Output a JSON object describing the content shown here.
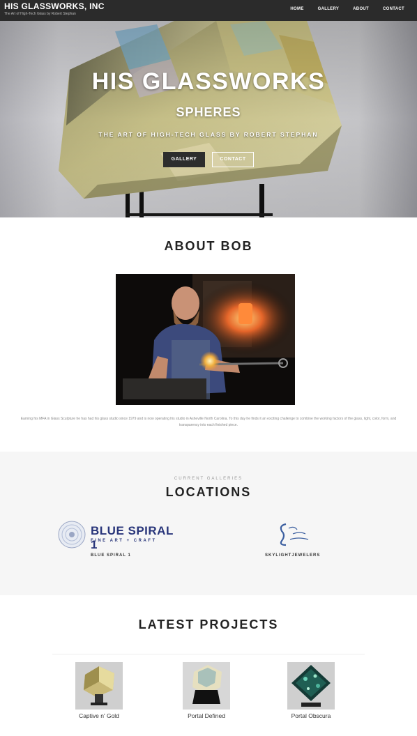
{
  "site": {
    "title": "HIS GLASSWORKS, INC",
    "tagline": "The Art of High-Tech Glass by Robert Stephan"
  },
  "nav": {
    "items": [
      {
        "label": "HOME"
      },
      {
        "label": "GALLERY"
      },
      {
        "label": "ABOUT"
      },
      {
        "label": "CONTACT"
      }
    ]
  },
  "hero": {
    "title": "HIS GLASSWORKS",
    "subtitle": "SPHERES",
    "tagline": "THE ART OF HIGH-TECH GLASS BY ROBERT STEPHAN",
    "gallery_button": "GALLERY",
    "contact_button": "CONTACT"
  },
  "about": {
    "title": "ABOUT BOB",
    "bio": "Earning his MFA in Glass Sculpture he has had his glass studio since 1979 and is now operating his studio in Asheville North Carolina. To this day he finds it an exciting challenge to combine the working factors of the glass, light, color, form, and transparency into each finished piece."
  },
  "locations": {
    "eyebrow": "CURRENT GALLERIES",
    "title": "LOCATIONS",
    "galleries": [
      {
        "logo_text": "BLUE SPIRAL 1",
        "logo_subtext": "FINE ART + CRAFT",
        "label": "BLUE SPIRAL 1"
      },
      {
        "logo_text": "Skylight Jewelers",
        "label": "SKYLIGHTJEWELERS"
      }
    ]
  },
  "projects": {
    "title": "LATEST PROJECTS",
    "items": [
      {
        "caption": "Captive n' Gold"
      },
      {
        "caption": "Portal Defined"
      },
      {
        "caption": "Portal Obscura"
      }
    ]
  }
}
